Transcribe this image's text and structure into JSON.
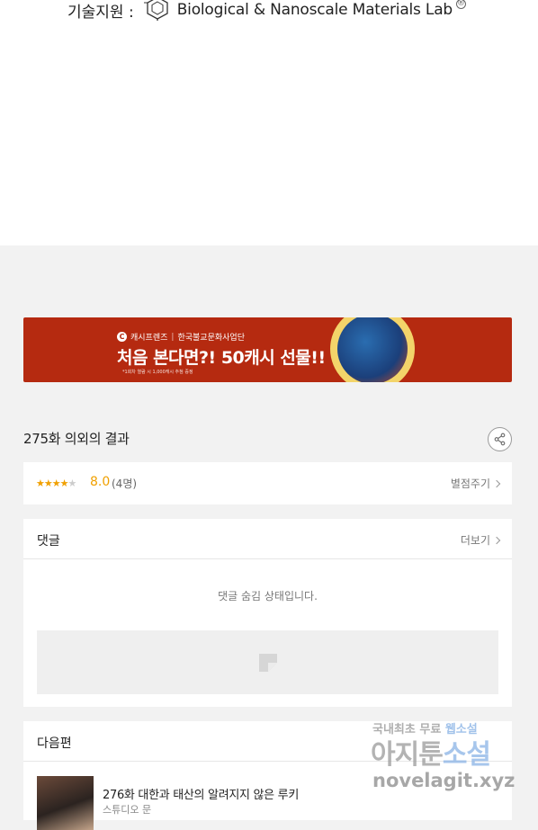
{
  "credit": {
    "prefix": "기술지원 :",
    "lab_name": "Biological & Nanoscale Materials Lab",
    "registered_mark": "®"
  },
  "banner": {
    "brand": "캐시프렌즈",
    "sponsor": "한국불교문화사업단",
    "headline": "처음 본다면?! 50캐시 선물!!",
    "note": "*1회차 열람 시 1,000캐시 추첨 증정",
    "art_icon": "dragon-medallion-icon"
  },
  "episode": {
    "title": "275화 의외의 결과",
    "share_icon": "share-icon"
  },
  "rating": {
    "stars_on": "★★★★",
    "stars_off": "★",
    "score": "8.0",
    "count": "(4명)",
    "rate_label": "별점주기"
  },
  "comments": {
    "label": "댓글",
    "more_label": "더보기",
    "hidden_message": "댓글 숨김 상태입니다."
  },
  "next": {
    "label": "다음편",
    "episode_title": "276화 대한과 태산의 알려지지 않은 루키",
    "studio": "스튜디오 문"
  },
  "watermark": {
    "line1_a": "국내최초 무료 ",
    "line1_b": "웹소설",
    "line2_a": "아지툰",
    "line2_b": "소설",
    "line3": "novelagit.xyz"
  },
  "colors": {
    "banner_bg": "#b52a10",
    "star": "#f0a000",
    "page_bg": "#f2f2f2"
  }
}
